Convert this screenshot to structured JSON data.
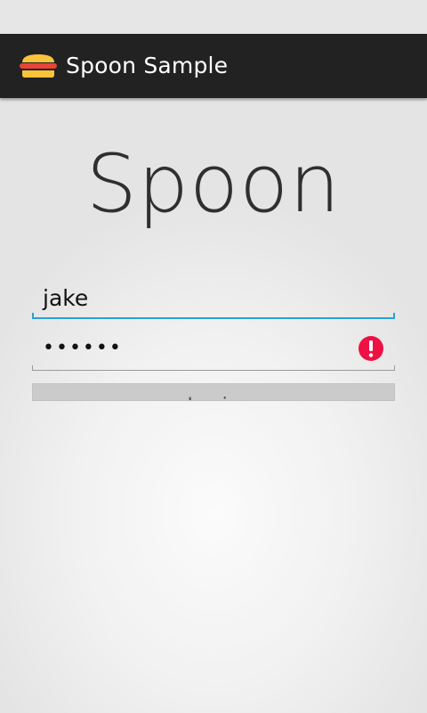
{
  "action_bar": {
    "title": "Spoon Sample",
    "icon": "burger-icon"
  },
  "main": {
    "logo_text": "Spoon",
    "username": {
      "value": "jake"
    },
    "password": {
      "value": "••••••",
      "error_icon": "error-icon"
    },
    "login_button": {
      "label": "Login"
    }
  },
  "colors": {
    "action_bar_bg": "#222222",
    "focus_accent": "#2aa0d4",
    "error_red": "#ee1144",
    "button_bg": "#cbcbcb"
  }
}
